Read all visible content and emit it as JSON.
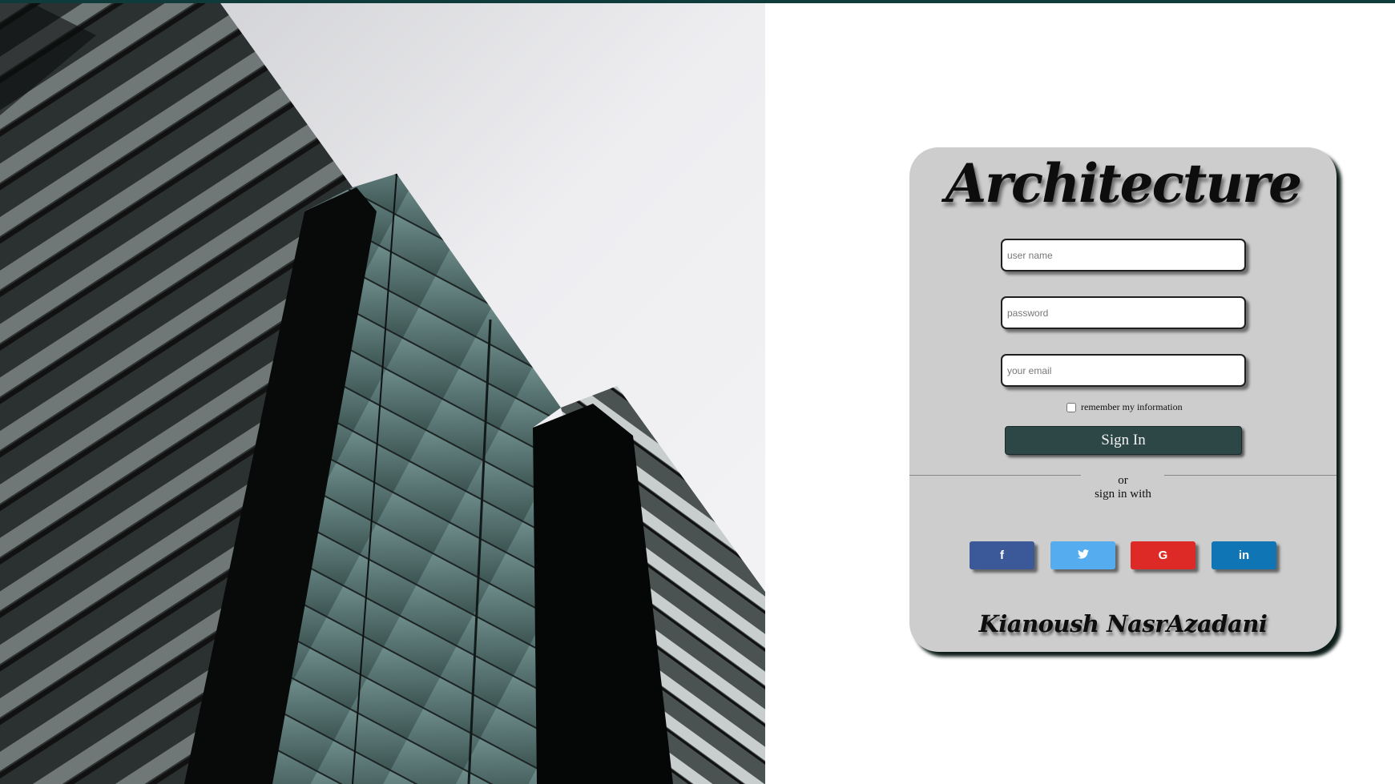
{
  "colors": {
    "accent_bar": "#0f3b3b",
    "card": "#cdcdcd",
    "signin_button": "#2d4747",
    "facebook": "#3b5998",
    "twitter": "#55acee",
    "google": "#dd2a26",
    "linkedin": "#0f75b5"
  },
  "brand": {
    "title": "Architecture"
  },
  "form": {
    "username_placeholder": "user name",
    "password_placeholder": "password",
    "email_placeholder": "your email",
    "remember_label": "remember my information",
    "remember_checked": false,
    "signin_label": "Sign In"
  },
  "alt": {
    "or": "or",
    "sign_in_with": "sign in with"
  },
  "social": [
    {
      "name": "facebook",
      "icon": "f"
    },
    {
      "name": "twitter",
      "icon": "twitter-bird"
    },
    {
      "name": "google",
      "icon": "G"
    },
    {
      "name": "linkedin",
      "icon": "in"
    }
  ],
  "footer": {
    "signature": "Kianoush NasrAzadani"
  }
}
